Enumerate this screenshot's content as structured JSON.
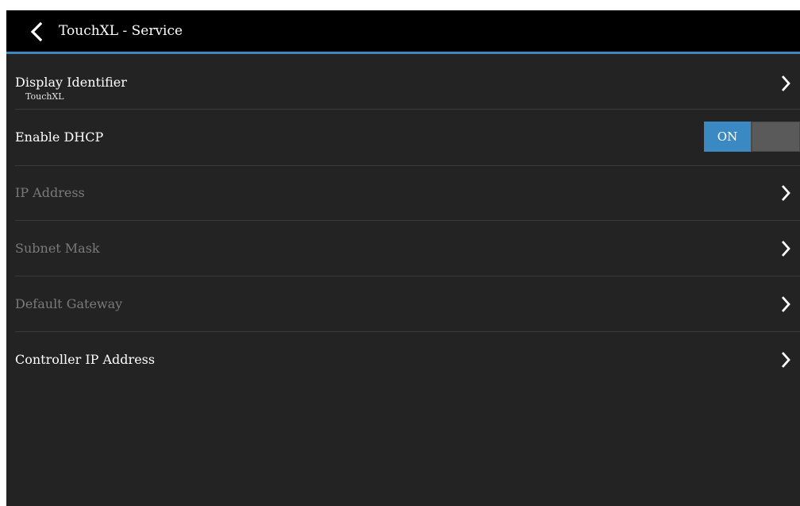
{
  "header": {
    "title": "TouchXL - Service",
    "back_icon": "chevron-left-icon"
  },
  "colors": {
    "accent": "#3a89c2",
    "background": "#232323",
    "titlebar": "#000000",
    "disabled_text": "#7a7a7a"
  },
  "settings": [
    {
      "label": "Display Identifier",
      "value": "TouchXL",
      "enabled": true,
      "type": "nav"
    },
    {
      "label": "Enable DHCP",
      "enabled": true,
      "type": "toggle",
      "toggle_label": "ON",
      "toggle_state": true
    },
    {
      "label": "IP Address",
      "enabled": false,
      "type": "nav"
    },
    {
      "label": "Subnet Mask",
      "enabled": false,
      "type": "nav"
    },
    {
      "label": "Default Gateway",
      "enabled": false,
      "type": "nav"
    },
    {
      "label": "Controller IP Address",
      "enabled": true,
      "type": "nav"
    }
  ]
}
